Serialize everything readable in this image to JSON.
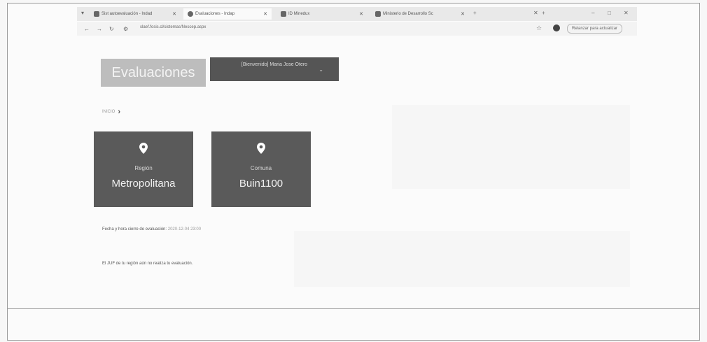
{
  "browser": {
    "tabs": [
      {
        "label": "Sist autoevaluación - Indad"
      },
      {
        "label": "Evaluaciones - Indap"
      },
      {
        "label": "ID Minedux"
      },
      {
        "label": "Ministerio de Desarrollo Sc"
      }
    ],
    "url": "slaef.fosis.cl/sistemas/Nescep.aspx",
    "update_label": "Relanzar para actualizar"
  },
  "page": {
    "brand": "Evaluaciones",
    "user_label": "[Bienvenido] Maria Jose Otero",
    "breadcrumb": "INICIO",
    "cards": [
      {
        "caption": "Región",
        "value": "Metropolitana"
      },
      {
        "caption": "Comuna",
        "value": "Buin1100"
      }
    ],
    "deadline_label": "Fecha y hora cierre de evaluación:",
    "deadline_value": "2020-12-04 23:00",
    "notice": "El JUF de tu región aún no realiza tu evaluación."
  }
}
